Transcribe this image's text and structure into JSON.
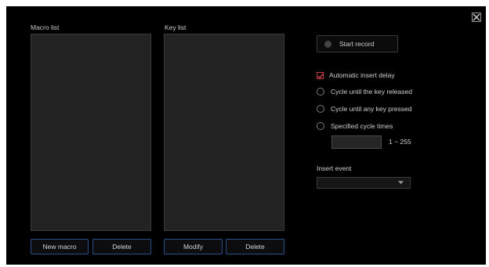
{
  "macro_list": {
    "label": "Macro list",
    "items": []
  },
  "key_list": {
    "label": "Key list",
    "items": []
  },
  "buttons": {
    "new_macro": "New macro",
    "delete_macro": "Delete",
    "modify": "Modify",
    "delete_key": "Delete"
  },
  "record": {
    "label": "Start record",
    "icon": "record-dot-icon"
  },
  "options": {
    "automatic_insert_delay": {
      "label": "Automatic insert delay",
      "checked": true
    },
    "cycle_until_released": {
      "label": "Cycle until the key released",
      "selected": false
    },
    "cycle_until_any_key": {
      "label": "Cycle until any key pressed",
      "selected": false
    },
    "specified_cycle_times": {
      "label": "Specified cycle times",
      "selected": false
    }
  },
  "cycle_times": {
    "value": "",
    "range_label": "1 ~ 255"
  },
  "insert_event": {
    "label": "Insert event",
    "selected": ""
  },
  "icons": {
    "close": "close-icon",
    "dropdown": "chevron-down-icon"
  },
  "colors": {
    "background": "#000000",
    "list_fill": "#222222",
    "button_border": "#2a4f8a",
    "checkbox_accent": "#c83a3a"
  }
}
